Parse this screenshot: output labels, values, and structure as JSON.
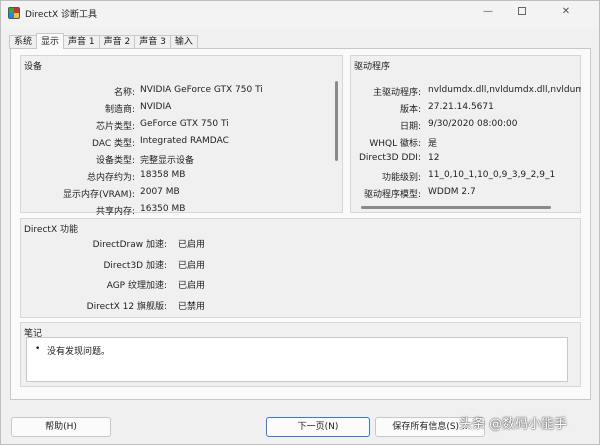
{
  "window": {
    "title": "DirectX 诊断工具"
  },
  "tabs": [
    {
      "label": "系统"
    },
    {
      "label": "显示"
    },
    {
      "label": "声音 1"
    },
    {
      "label": "声音 2"
    },
    {
      "label": "声音 3"
    },
    {
      "label": "输入"
    }
  ],
  "device": {
    "title": "设备",
    "rows": [
      {
        "label": "名称:",
        "value": "NVIDIA GeForce GTX 750 Ti"
      },
      {
        "label": "制造商:",
        "value": "NVIDIA"
      },
      {
        "label": "芯片类型:",
        "value": "GeForce GTX 750 Ti"
      },
      {
        "label": "DAC 类型:",
        "value": "Integrated RAMDAC"
      },
      {
        "label": "设备类型:",
        "value": "完整显示设备"
      },
      {
        "label": "总内存约为:",
        "value": "18358 MB"
      },
      {
        "label": "显示内存(VRAM):",
        "value": "2007 MB"
      },
      {
        "label": "共享内存:",
        "value": "16350 MB"
      }
    ]
  },
  "driver": {
    "title": "驱动程序",
    "rows": [
      {
        "label": "主驱动程序:",
        "value": "nvldumdx.dll,nvldumdx.dll,nvldumdx.d"
      },
      {
        "label": "版本:",
        "value": "27.21.14.5671"
      },
      {
        "label": "日期:",
        "value": "9/30/2020 08:00:00"
      },
      {
        "label": "WHQL 徽标:",
        "value": "是"
      },
      {
        "label": "Direct3D DDI:",
        "value": "12"
      },
      {
        "label": "功能级别:",
        "value": "11_0,10_1,10_0,9_3,9_2,9_1"
      },
      {
        "label": "驱动程序模型:",
        "value": "WDDM 2.7"
      }
    ]
  },
  "features": {
    "title": "DirectX 功能",
    "rows": [
      {
        "label": "DirectDraw 加速:",
        "value": "已启用"
      },
      {
        "label": "Direct3D 加速:",
        "value": "已启用"
      },
      {
        "label": "AGP 纹理加速:",
        "value": "已启用"
      },
      {
        "label": "DirectX 12 旗舰版:",
        "value": "已禁用"
      }
    ]
  },
  "notes": {
    "title": "笔记",
    "items": [
      "没有发现问题。"
    ]
  },
  "buttons": {
    "help": "帮助(H)",
    "next": "下一页(N)",
    "save": "保存所有信息(S)..."
  },
  "watermark": "头条 @数码小能手"
}
